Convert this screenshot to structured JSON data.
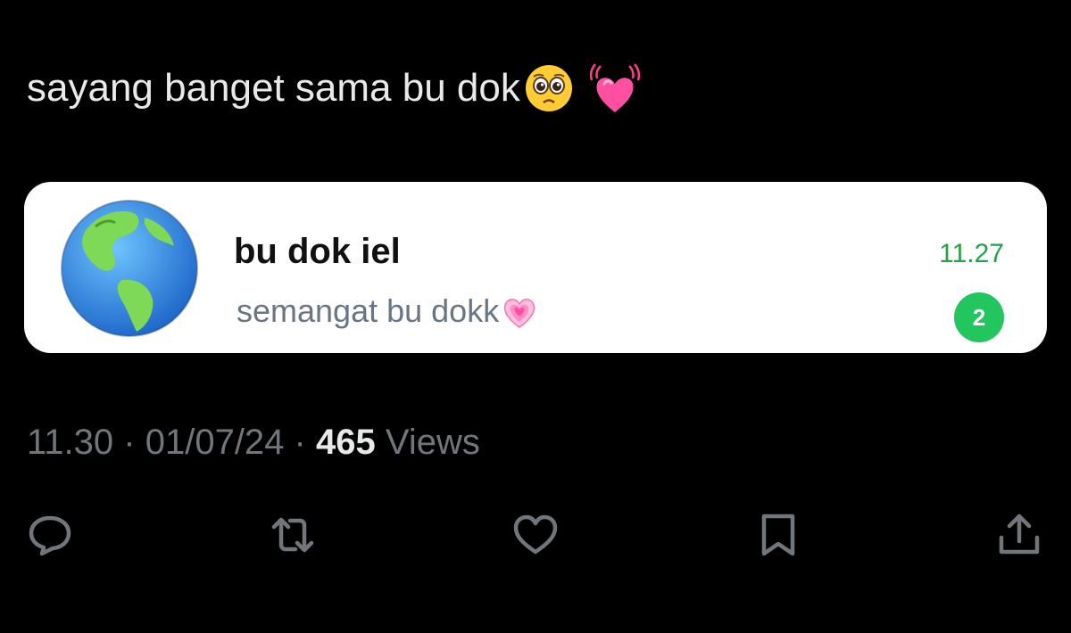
{
  "tweet": {
    "text": "sayang banget sama bu dok",
    "emojis": [
      "pleading-face-emoji",
      "beating-heart-emoji"
    ]
  },
  "chat_card": {
    "name": "bu dok iel",
    "preview": "semangat bu dokk",
    "preview_emoji": "growing-heart-emoji",
    "time": "11.27",
    "unread_count": "2",
    "avatar_icon": "globe-icon",
    "time_color": "#25a244",
    "badge_color": "#22c55e"
  },
  "meta": {
    "time": "11.30",
    "separator": "·",
    "date": "01/07/24",
    "views_count": "465",
    "views_label": "Views"
  },
  "actions": {
    "reply_icon": "reply-icon",
    "retweet_icon": "retweet-icon",
    "like_icon": "heart-icon",
    "bookmark_icon": "bookmark-icon",
    "share_icon": "share-icon"
  }
}
